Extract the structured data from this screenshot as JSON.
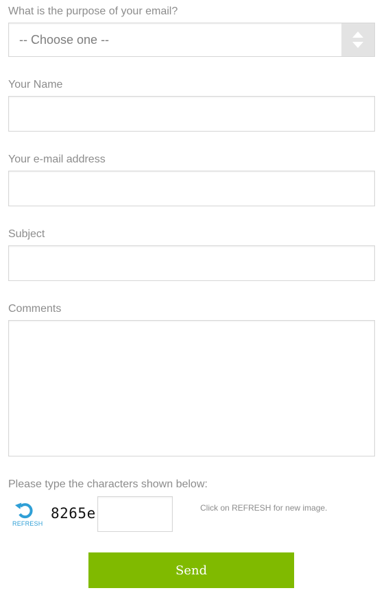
{
  "purpose": {
    "label": "What is the purpose of your email?",
    "selected": "-- Choose one --"
  },
  "name": {
    "label": "Your Name",
    "value": ""
  },
  "email": {
    "label": "Your e-mail address",
    "value": ""
  },
  "subject": {
    "label": "Subject",
    "value": ""
  },
  "comments": {
    "label": "Comments",
    "value": ""
  },
  "captcha": {
    "label": "Please type the characters shown below:",
    "refresh_label": "REFRESH",
    "refresh_icon": "refresh-icon",
    "code": "8265e",
    "value": "",
    "hint": "Click on REFRESH for new image."
  },
  "actions": {
    "send_label": "Send"
  },
  "colors": {
    "accent": "#80ba00",
    "refresh": "#2f9fd6",
    "border": "#d6d6d6",
    "label_text": "#8c8c8c"
  }
}
